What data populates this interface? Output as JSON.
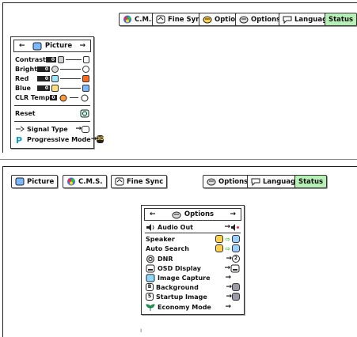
{
  "top": {
    "tabs": [
      {
        "label": "C.M.S.",
        "icon": "cms-icon"
      },
      {
        "label": "Fine Sync",
        "icon": "fine-sync-icon"
      },
      {
        "label": "Options",
        "icon": "options-icon"
      },
      {
        "label": "Options",
        "icon": "options-icon"
      },
      {
        "label": "Language",
        "icon": "language-icon"
      },
      {
        "label": "Status",
        "icon": "",
        "color": "#b6f0b6"
      }
    ],
    "picture_menu": {
      "title": "Picture",
      "rows": [
        {
          "label": "Contrast",
          "value": "0",
          "color": "#cfcfcf"
        },
        {
          "label": "Bright",
          "value": "0",
          "color": "#d8d8d8"
        },
        {
          "label": "Red",
          "value": "0",
          "color": "#9ee6ff",
          "end_color": "#ff6a1a"
        },
        {
          "label": "Blue",
          "value": "0",
          "color": "#ffe07a",
          "end_color": "#7ab8ff"
        },
        {
          "label": "CLR Temp",
          "value": "0",
          "color": "#ff9a3a"
        }
      ],
      "reset": "Reset",
      "signal_type": "Signal Type",
      "progressive_mode": "Progressive Mode",
      "progressive_value": "3D"
    }
  },
  "bottom": {
    "tabs": [
      {
        "label": "Picture",
        "icon": "picture-icon"
      },
      {
        "label": "C.M.S.",
        "icon": "cms-icon"
      },
      {
        "label": "Fine Sync",
        "icon": "fine-sync-icon"
      },
      {
        "label": "Options",
        "icon": "options-icon"
      },
      {
        "label": "Language",
        "icon": "language-icon"
      },
      {
        "label": "Status",
        "icon": "",
        "color": "#b6f0b6"
      }
    ],
    "options_menu": {
      "title": "Options",
      "rows": [
        {
          "label": "Audio Out",
          "icon": "speaker-icon"
        },
        {
          "label": "Speaker",
          "icon": ""
        },
        {
          "label": "Auto Search",
          "icon": ""
        },
        {
          "label": "DNR",
          "icon": "dnr-icon",
          "value": "2"
        },
        {
          "label": "OSD Display",
          "icon": "osd-icon"
        },
        {
          "label": "Image Capture",
          "icon": "image-capture-icon"
        },
        {
          "label": "Background",
          "icon": "background-icon",
          "value": "B"
        },
        {
          "label": "Startup Image",
          "icon": "startup-icon",
          "value": "S"
        },
        {
          "label": "Economy Mode",
          "icon": "economy-icon"
        }
      ]
    }
  },
  "footer_mark": "ı"
}
